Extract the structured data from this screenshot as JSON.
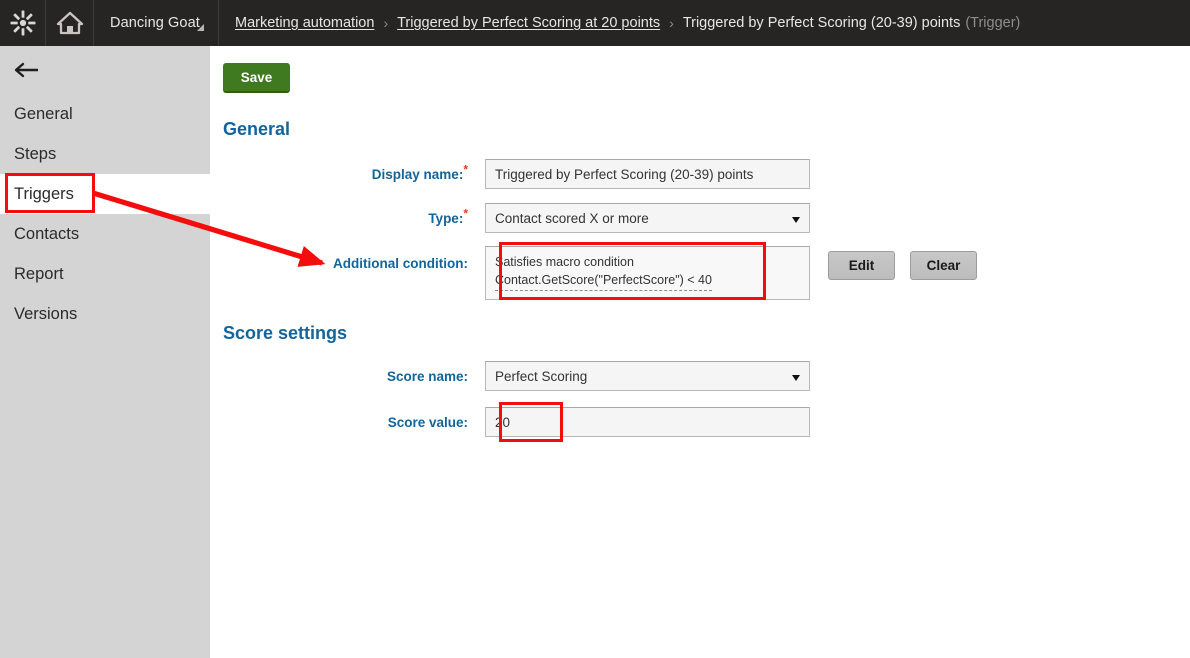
{
  "topbar": {
    "logo_icon": "kentico-star-icon",
    "home_icon": "home-icon",
    "site_name": "Dancing Goat",
    "site_caret_icon": "corner-triangle-icon",
    "breadcrumb": {
      "items": [
        {
          "label": "Marketing automation",
          "type": "link"
        },
        {
          "label": "Triggered by Perfect Scoring at 20 points",
          "type": "link"
        },
        {
          "label": "Triggered by Perfect Scoring (20-39) points",
          "type": "current",
          "suffix": "(Trigger)"
        }
      ],
      "separator": "›"
    }
  },
  "sidebar": {
    "back_icon": "back-arrow-icon",
    "items": [
      {
        "label": "General",
        "active": false
      },
      {
        "label": "Steps",
        "active": false
      },
      {
        "label": "Triggers",
        "active": true
      },
      {
        "label": "Contacts",
        "active": false
      },
      {
        "label": "Report",
        "active": false
      },
      {
        "label": "Versions",
        "active": false
      }
    ]
  },
  "toolbar": {
    "save_label": "Save"
  },
  "sections": {
    "general": {
      "title": "General",
      "display_name": {
        "label": "Display name:",
        "required": "*",
        "value": "Triggered by Perfect Scoring (20-39) points"
      },
      "type": {
        "label": "Type:",
        "required": "*",
        "value": "Contact scored X or more",
        "caret_icon": "chevron-down-icon"
      },
      "additional_condition": {
        "label": "Additional condition:",
        "line1": "Satisfies macro condition",
        "line2": "Contact.GetScore(\"PerfectScore\") < 40",
        "edit_label": "Edit",
        "clear_label": "Clear"
      }
    },
    "score_settings": {
      "title": "Score settings",
      "score_name": {
        "label": "Score name:",
        "value": "Perfect Scoring",
        "caret_icon": "chevron-down-icon"
      },
      "score_value": {
        "label": "Score value:",
        "value": "20"
      }
    }
  },
  "annotations": {
    "color": "#f40d0d",
    "arrow_icon": "red-arrow-icon",
    "highlight_triggers": "Triggers",
    "highlight_condition": "Additional condition value",
    "highlight_score_value": "Score value"
  },
  "colors": {
    "topbar_bg": "#262524",
    "sidebar_bg": "#d4d4d4",
    "accent_blue": "#12649b",
    "save_green": "#3f7a21",
    "required_red": "#e03b20",
    "annotation_red": "#f40d0d"
  }
}
